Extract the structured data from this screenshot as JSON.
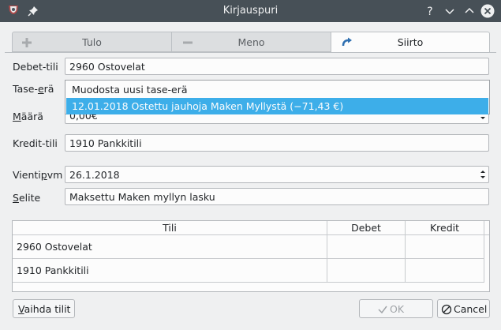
{
  "window": {
    "title": "Kirjauspuri"
  },
  "tabs": [
    {
      "label": "Tulo",
      "icon": "plus-icon"
    },
    {
      "label": "Meno",
      "icon": "minus-icon"
    },
    {
      "label": "Siirto",
      "icon": "transfer-arrow-icon",
      "active": true
    }
  ],
  "form": {
    "debet_label": "Debet-tili",
    "debet_value": "2960 Ostovelat",
    "tase_label": "Tase-erä",
    "maara_label": "Määrä",
    "maara_value": "0,00€",
    "kredit_label": "Kredit-tili",
    "kredit_value": "1910 Pankkitili",
    "pvm_label": "Vientipvm",
    "pvm_value": "26.1.2018",
    "selite_label": "Selite",
    "selite_value": "Maksettu Maken myllyn lasku"
  },
  "dropdown": {
    "options": [
      "Muodosta uusi tase-erä",
      "12.01.2018 Ostettu jauhoja Maken Myllystä (−71,43 €)"
    ],
    "highlighted_index": 1
  },
  "table": {
    "headers": [
      "Tili",
      "Debet",
      "Kredit"
    ],
    "rows": [
      [
        "2960 Ostovelat",
        "",
        ""
      ],
      [
        "1910 Pankkitili",
        "",
        ""
      ]
    ]
  },
  "buttons": {
    "swap": "Vaihda tilit",
    "ok": "OK",
    "cancel": "Cancel"
  },
  "colors": {
    "titlebar": "#475057",
    "highlight": "#3daee9"
  }
}
